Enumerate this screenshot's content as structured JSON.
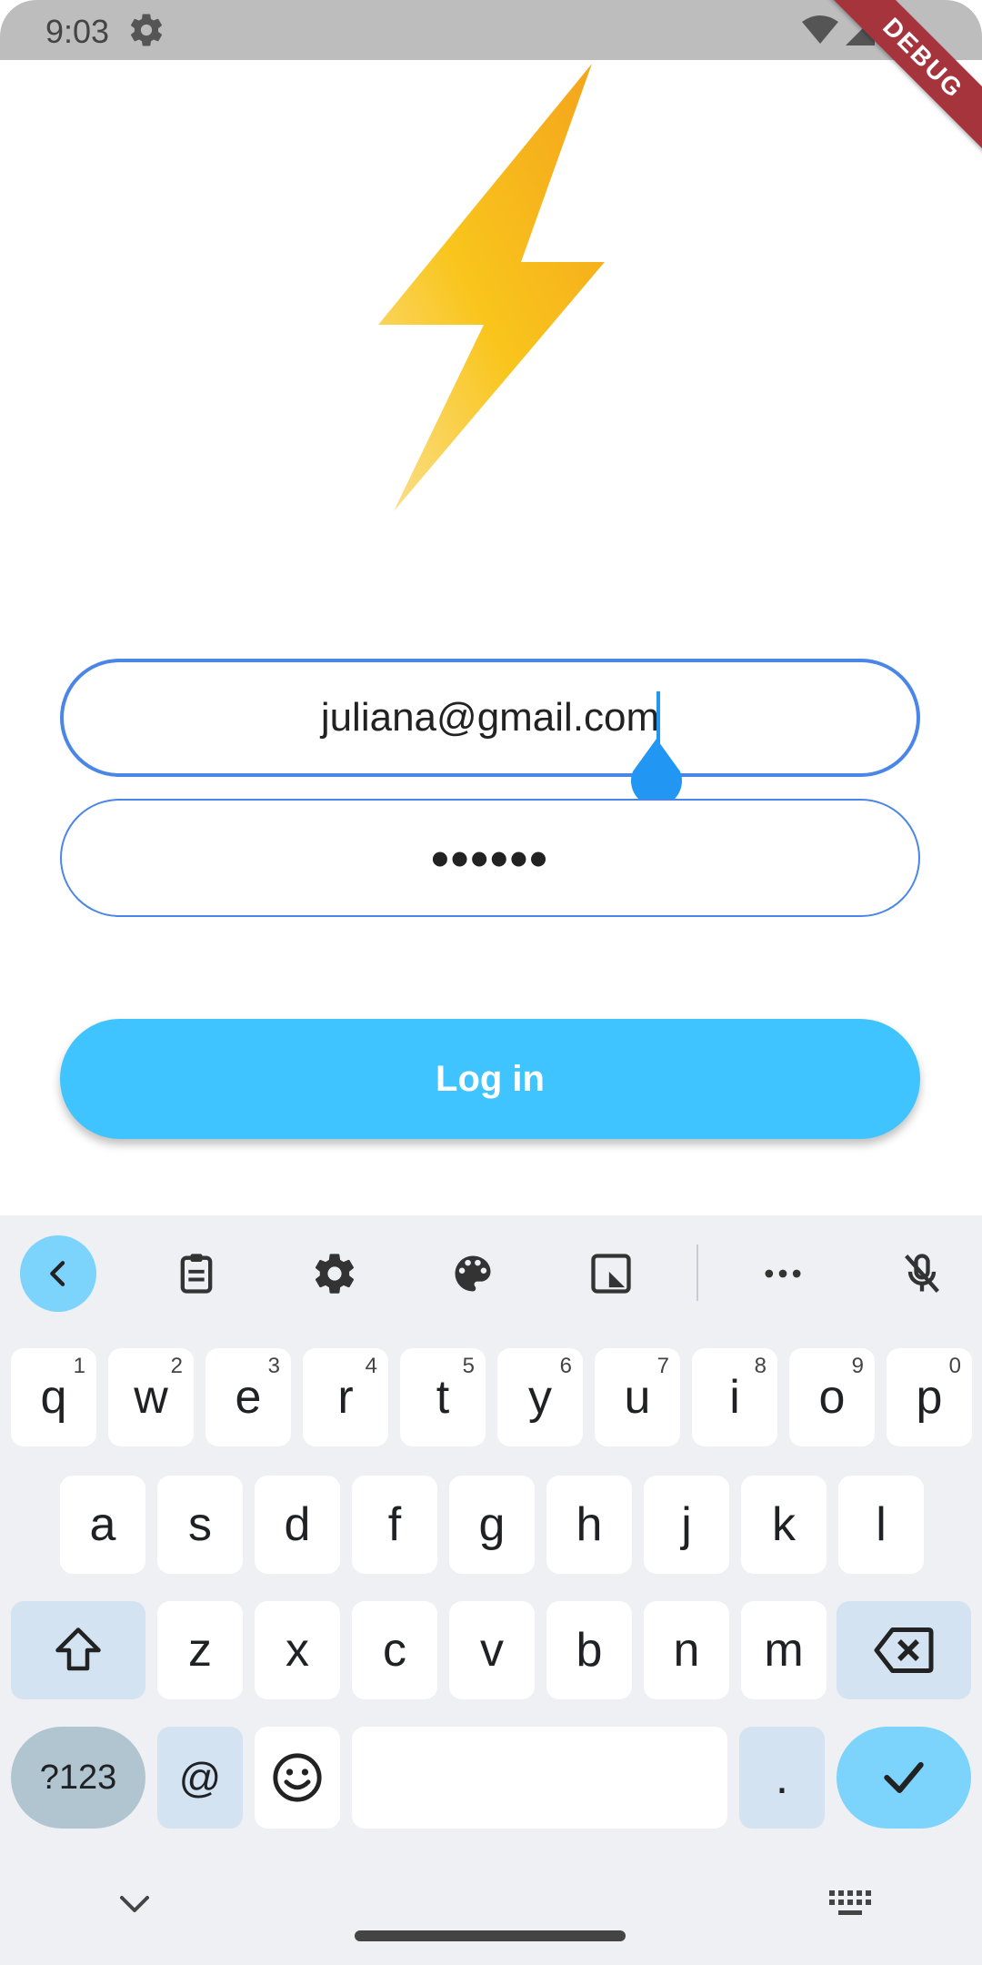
{
  "status_bar": {
    "time": "9:03",
    "debug_label": "DEBUG"
  },
  "login_form": {
    "email_value": "juliana@gmail.com",
    "password_masked": "••••••",
    "login_label": "Log in"
  },
  "colors": {
    "accent_blue": "#4a86e8",
    "button_blue": "#40c4ff",
    "bolt_orange": "#f4a31c",
    "bolt_yellow": "#f9c51c",
    "debug_red": "#a5343d"
  },
  "keyboard": {
    "toolbar_icons": [
      "back-icon",
      "clipboard-icon",
      "settings-icon",
      "palette-icon",
      "resize-icon",
      "more-icon",
      "mic-off-icon"
    ],
    "row1": [
      {
        "key": "q",
        "num": "1"
      },
      {
        "key": "w",
        "num": "2"
      },
      {
        "key": "e",
        "num": "3"
      },
      {
        "key": "r",
        "num": "4"
      },
      {
        "key": "t",
        "num": "5"
      },
      {
        "key": "y",
        "num": "6"
      },
      {
        "key": "u",
        "num": "7"
      },
      {
        "key": "i",
        "num": "8"
      },
      {
        "key": "o",
        "num": "9"
      },
      {
        "key": "p",
        "num": "0"
      }
    ],
    "row2": [
      "a",
      "s",
      "d",
      "f",
      "g",
      "h",
      "j",
      "k",
      "l"
    ],
    "row3": [
      "z",
      "x",
      "c",
      "v",
      "b",
      "n",
      "m"
    ],
    "symbols_label": "?123",
    "at_label": "@",
    "period_label": "."
  }
}
